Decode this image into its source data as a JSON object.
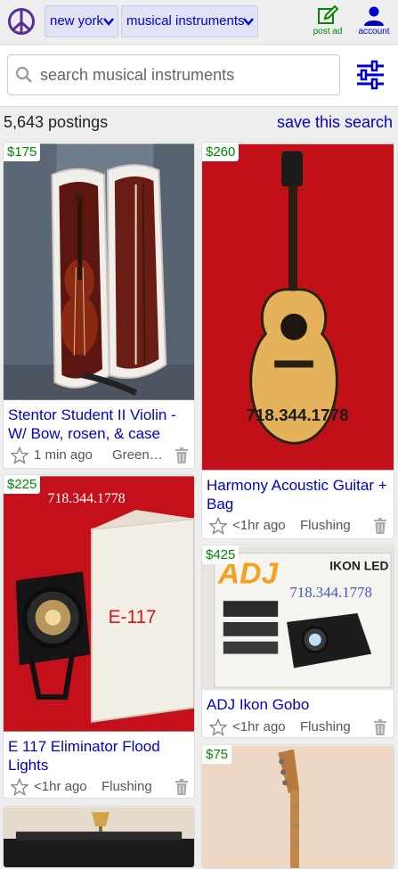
{
  "header": {
    "logo_icon": "peace-sign-icon",
    "city": "new york",
    "category": "musical instruments",
    "post_ad_label": "post ad",
    "account_label": "account",
    "colors": {
      "link": "#0000cc",
      "post": "#008800",
      "accent": "#5c2e91"
    }
  },
  "search": {
    "placeholder": "search musical instruments",
    "filters_icon": "sliders-icon"
  },
  "results": {
    "count": "5,643 postings",
    "save_label": "save this search"
  },
  "listings": [
    {
      "price": "$175",
      "title": "Stentor Student II Violin - W/ Bow, rosen, & case",
      "time": "1 min ago",
      "location": "Greenpoint"
    },
    {
      "price": "$260",
      "title": "Harmony Acoustic Guitar + Bag",
      "time": "<1hr ago",
      "location": "Flushing",
      "photo_text": "718.344.1778"
    },
    {
      "price": "$225",
      "title": "E 117 Eliminator Flood Lights",
      "time": "<1hr ago",
      "location": "Flushing",
      "photo_text": "718.344.1778",
      "box_text": "E-117"
    },
    {
      "price": "$425",
      "title": "ADJ Ikon Gobo",
      "time": "<1hr ago",
      "location": "Flushing",
      "photo_text": "718.344.1778",
      "brand_text": "IKON LED"
    },
    {
      "price": "$75"
    },
    {}
  ]
}
